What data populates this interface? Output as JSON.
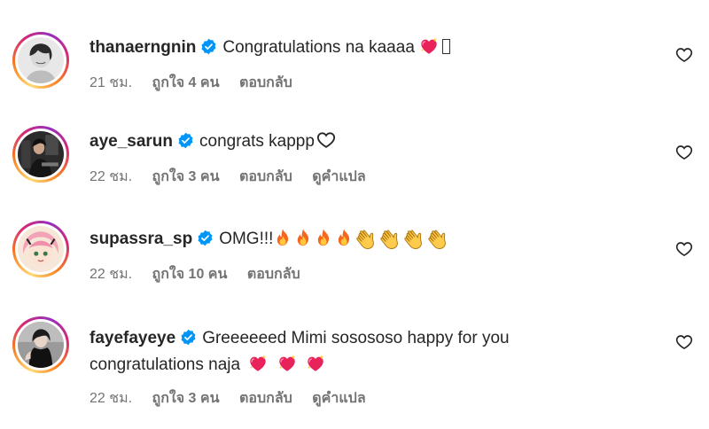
{
  "comments": [
    {
      "username": "thanaerngnin",
      "text": "Congratulations na kaaaa",
      "emojis": [
        "sparkling-heart-icon",
        "missing-glyph"
      ],
      "time": "21 ชม.",
      "likes": "ถูกใจ 4 คน",
      "reply": "ตอบกลับ",
      "translate": null
    },
    {
      "username": "aye_sarun",
      "text": "congrats kappp",
      "emojis": [
        "white-heart-icon"
      ],
      "time": "22 ชม.",
      "likes": "ถูกใจ 3 คน",
      "reply": "ตอบกลับ",
      "translate": "ดูคำแปล"
    },
    {
      "username": "supassra_sp",
      "text": "OMG!!!",
      "emojis": [
        "fire-icon",
        "fire-icon",
        "fire-icon",
        "fire-icon",
        "clapping-hands-icon",
        "clapping-hands-icon",
        "clapping-hands-icon",
        "clapping-hands-icon"
      ],
      "time": "22 ชม.",
      "likes": "ถูกใจ 10 คน",
      "reply": "ตอบกลับ",
      "translate": null
    },
    {
      "username": "fayefayeye",
      "text": "Greeeeeed Mimi sosososo happy for you",
      "text2": "congratulations naja",
      "emojis": [
        "sparkling-heart-icon",
        "sparkling-heart-icon",
        "sparkling-heart-icon"
      ],
      "time": "22 ชม.",
      "likes": "ถูกใจ 3 คน",
      "reply": "ตอบกลับ",
      "translate": "ดูคำแปล"
    }
  ],
  "colors": {
    "verified": "#0095f6",
    "meta_text": "#737373",
    "text": "#262626"
  }
}
